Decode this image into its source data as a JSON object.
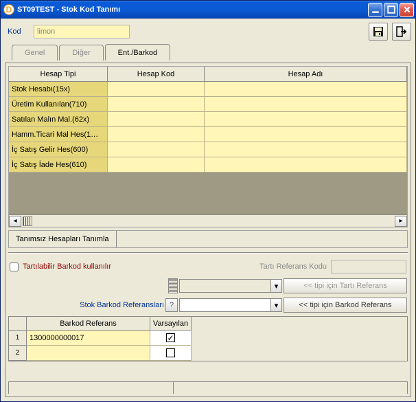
{
  "window": {
    "title": "ST09TEST - Stok Kod Tanımı",
    "icon_letter": "D"
  },
  "top": {
    "kod_label": "Kod",
    "kod_value": "limon"
  },
  "tabs": {
    "genel": "Genel",
    "diger": "Diğer",
    "ent": "Ent./Barkod"
  },
  "grid": {
    "headers": {
      "h0": "Hesap Tipi",
      "h1": "Hesap Kod",
      "h2": "Hesap Adı"
    },
    "rows": [
      {
        "tip": "Stok Hesabı(15x)",
        "kod": "",
        "ad": ""
      },
      {
        "tip": "Üretim Kullanılan(710)",
        "kod": "",
        "ad": ""
      },
      {
        "tip": "Satılan Malın Mal.(62x)",
        "kod": "",
        "ad": ""
      },
      {
        "tip": "Hamm.Ticari Mal Hes(1…",
        "kod": "",
        "ad": ""
      },
      {
        "tip": "İç Satış Gelir Hes(600)",
        "kod": "",
        "ad": ""
      },
      {
        "tip": "İç Satış İade Hes(610)",
        "kod": "",
        "ad": ""
      }
    ]
  },
  "buttons": {
    "define": "Tanımsız Hesapları Tanımla",
    "tarti_ref": "<< tipi için Tartı Referans",
    "barkod_ref": "<< tipi için Barkod Referans"
  },
  "lower": {
    "tartilabilir": "Tartılabilir Barkod kullanılır",
    "tarti_ref_kodu": "Tartı Referans Kodu",
    "stok_barkod_ref": "Stok Barkod Referansları",
    "help_q": "?"
  },
  "bgrid": {
    "headers": {
      "h1": "Barkod Referans",
      "h2": "Varsayılan"
    },
    "rows": [
      {
        "n": "1",
        "ref": "1300000000017",
        "def": true
      },
      {
        "n": "2",
        "ref": "",
        "def": false
      }
    ]
  }
}
